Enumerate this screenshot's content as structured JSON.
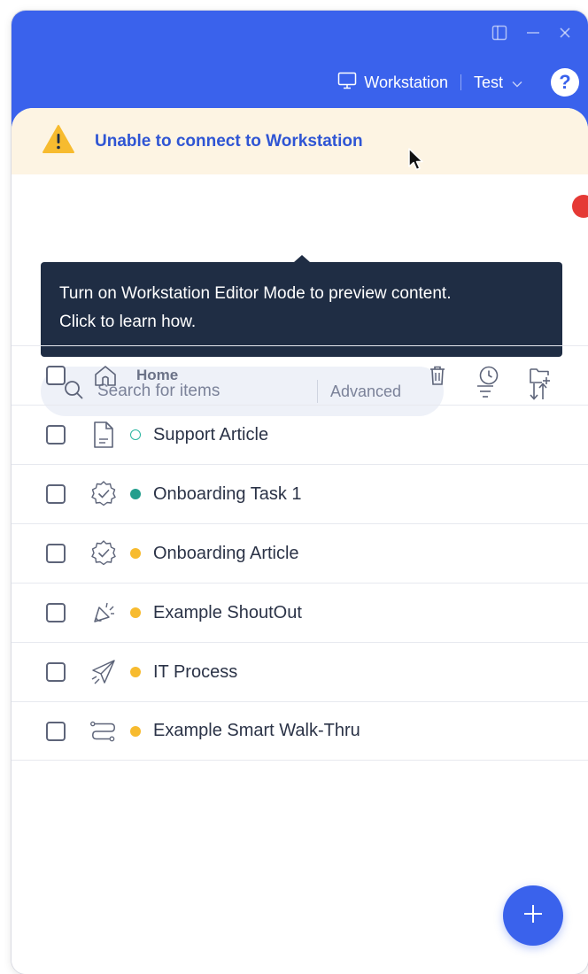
{
  "header": {
    "workstation_label": "Workstation",
    "environment_label": "Test",
    "help_label": "?"
  },
  "warning": {
    "message": "Unable to connect to Workstation"
  },
  "tooltip": {
    "line1": "Turn on Workstation Editor Mode to preview content.",
    "line2": "Click to learn how."
  },
  "search": {
    "placeholder": "Search for items",
    "advanced_label": "Advanced"
  },
  "home_row": {
    "label": "Home"
  },
  "items": [
    {
      "label": "Support Article",
      "icon": "article-icon",
      "status": "hollow-teal"
    },
    {
      "label": "Onboarding Task 1",
      "icon": "onboarding-task-icon",
      "status": "green"
    },
    {
      "label": "Onboarding Article",
      "icon": "onboarding-task-icon",
      "status": "yellow"
    },
    {
      "label": "Example ShoutOut",
      "icon": "shoutout-icon",
      "status": "yellow"
    },
    {
      "label": "IT Process",
      "icon": "paper-plane-icon",
      "status": "yellow"
    },
    {
      "label": "Example Smart Walk-Thru",
      "icon": "smart-walkthru-icon",
      "status": "yellow"
    }
  ],
  "colors": {
    "brand": "#3a62ec",
    "warning_bg": "#fdf4e3",
    "tooltip_bg": "#1f2d44",
    "status_green": "#239e8d",
    "status_yellow": "#f7bb2f",
    "alert_red": "#e53935"
  }
}
